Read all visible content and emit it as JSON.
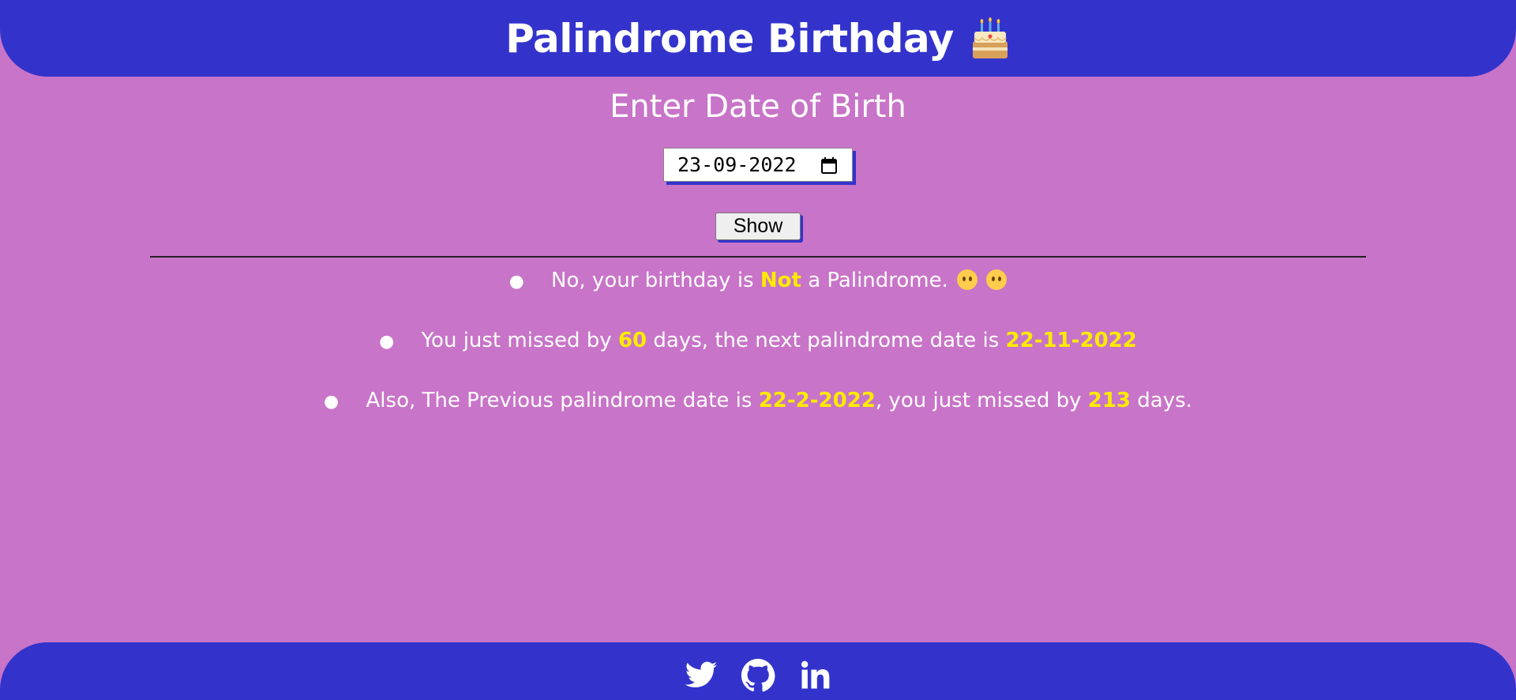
{
  "header": {
    "title": "Palindrome Birthday",
    "icon": "birthday-cake-icon"
  },
  "form": {
    "label": "Enter Date of Birth",
    "date_value": "23-09-2022",
    "calendar_icon": "calendar-icon",
    "button_label": "Show"
  },
  "results": {
    "line1": {
      "prefix": "No, your birthday is ",
      "highlight": "Not",
      "suffix": " a Palindrome.",
      "emoji_1": "🥺",
      "emoji_2": "☹"
    },
    "line2": {
      "prefix": "You just missed by ",
      "days": "60",
      "middle": " days, the next palindrome date is ",
      "next_date": "22-11-2022"
    },
    "line3": {
      "prefix": "Also, The Previous palindrome date is ",
      "prev_date": "22-2-2022",
      "middle": ", you just missed by ",
      "days": "213",
      "suffix": " days."
    }
  },
  "footer": {
    "links": [
      "twitter-icon",
      "github-icon",
      "linkedin-icon"
    ]
  },
  "colors": {
    "background": "#c874c8",
    "header": "#3333cc",
    "highlight": "#ffeb00"
  }
}
